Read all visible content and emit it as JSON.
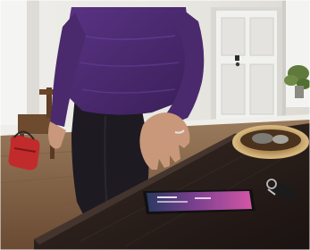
{
  "photo": {
    "colors": {
      "wall": "#e9e7e1",
      "floor": "#8a6a4c",
      "table": "#2b211d",
      "sweater": "#4c2a6f",
      "leggings": "#1d1a22",
      "skin": "#c9987b",
      "phone_screen": "#b24aa8",
      "door": "#f1f1ee"
    },
    "objects": [
      "person-purple-sweater-icon",
      "smartphone-on-table-icon",
      "wicker-basket-icon",
      "car-keys-icon",
      "front-door-icon",
      "red-bag-icon",
      "wooden-chair-icon",
      "houseplant-icon"
    ]
  }
}
